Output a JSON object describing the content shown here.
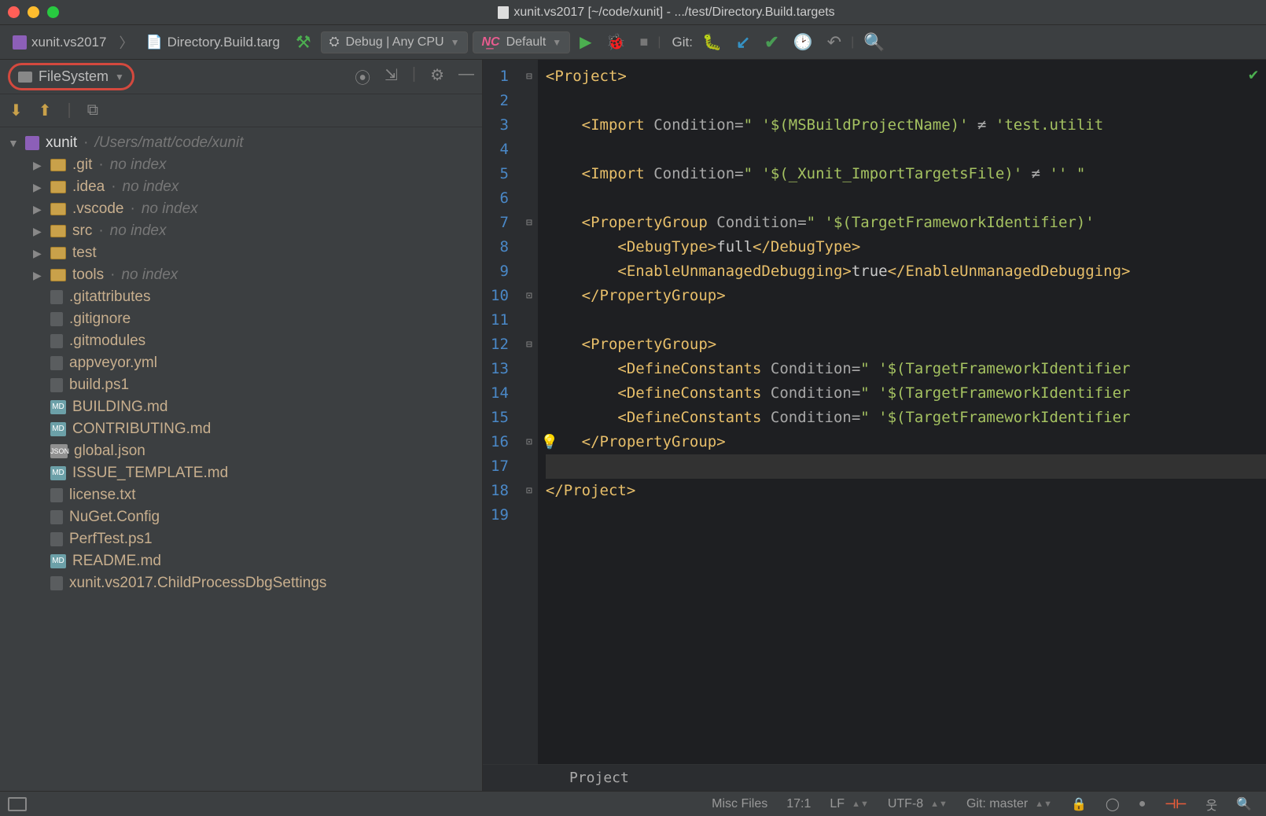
{
  "window": {
    "title": "xunit.vs2017 [~/code/xunit] - .../test/Directory.Build.targets"
  },
  "toolbar": {
    "breadcrumb1": "xunit.vs2017",
    "breadcrumb2": "Directory.Build.targ",
    "config": "Debug | Any CPU",
    "run_config": "Default",
    "git_label": "Git:"
  },
  "sidebar": {
    "scope": "FileSystem",
    "root": {
      "name": "xunit",
      "path": "/Users/matt/code/xunit"
    },
    "items": [
      {
        "name": ".git",
        "hint": "no index",
        "folder": true,
        "expandable": true
      },
      {
        "name": ".idea",
        "hint": "no index",
        "folder": true,
        "expandable": true
      },
      {
        "name": ".vscode",
        "hint": "no index",
        "folder": true,
        "expandable": true
      },
      {
        "name": "src",
        "hint": "no index",
        "folder": true,
        "expandable": true
      },
      {
        "name": "test",
        "folder": true,
        "expandable": true
      },
      {
        "name": "tools",
        "hint": "no index",
        "folder": true,
        "expandable": true
      },
      {
        "name": ".gitattributes",
        "icon": "file"
      },
      {
        "name": ".gitignore",
        "icon": "file"
      },
      {
        "name": ".gitmodules",
        "icon": "file"
      },
      {
        "name": "appveyor.yml",
        "icon": "file"
      },
      {
        "name": "build.ps1",
        "icon": "file"
      },
      {
        "name": "BUILDING.md",
        "icon": "md"
      },
      {
        "name": "CONTRIBUTING.md",
        "icon": "md"
      },
      {
        "name": "global.json",
        "icon": "json"
      },
      {
        "name": "ISSUE_TEMPLATE.md",
        "icon": "md"
      },
      {
        "name": "license.txt",
        "icon": "file"
      },
      {
        "name": "NuGet.Config",
        "icon": "file"
      },
      {
        "name": "PerfTest.ps1",
        "icon": "file"
      },
      {
        "name": "README.md",
        "icon": "md"
      },
      {
        "name": "xunit.vs2017.ChildProcessDbgSettings",
        "icon": "file"
      }
    ]
  },
  "editor": {
    "breadcrumb": "Project",
    "lines": [
      {
        "n": 1,
        "html": "<span class='tag'>&lt;Project&gt;</span>"
      },
      {
        "n": 2,
        "html": ""
      },
      {
        "n": 3,
        "html": "    <span class='tag'>&lt;Import</span> <span class='attr'>Condition=</span><span class='val'>\" '$(MSBuildProjectName)' </span><span class='op'>≠</span><span class='val'> 'test.utilit</span>"
      },
      {
        "n": 4,
        "html": ""
      },
      {
        "n": 5,
        "html": "    <span class='tag'>&lt;Import</span> <span class='attr'>Condition=</span><span class='val'>\" '$(_Xunit_ImportTargetsFile)' </span><span class='op'>≠</span><span class='val'> '' \" </span>"
      },
      {
        "n": 6,
        "html": ""
      },
      {
        "n": 7,
        "html": "    <span class='tag'>&lt;PropertyGroup</span> <span class='attr'>Condition=</span><span class='val'>\" '$(TargetFrameworkIdentifier)' </span>"
      },
      {
        "n": 8,
        "html": "        <span class='tag'>&lt;DebugType&gt;</span><span class='txt'>full</span><span class='tag'>&lt;/DebugType&gt;</span>"
      },
      {
        "n": 9,
        "html": "        <span class='tag'>&lt;EnableUnmanagedDebugging&gt;</span><span class='txt'>true</span><span class='tag'>&lt;/EnableUnmanagedDebugging&gt;</span>"
      },
      {
        "n": 10,
        "html": "    <span class='tag'>&lt;/PropertyGroup&gt;</span>"
      },
      {
        "n": 11,
        "html": ""
      },
      {
        "n": 12,
        "html": "    <span class='tag'>&lt;PropertyGroup&gt;</span>"
      },
      {
        "n": 13,
        "html": "        <span class='tag'>&lt;DefineConstants</span> <span class='attr'>Condition=</span><span class='val'>\" '$(TargetFrameworkIdentifier</span>"
      },
      {
        "n": 14,
        "html": "        <span class='tag'>&lt;DefineConstants</span> <span class='attr'>Condition=</span><span class='val'>\" '$(TargetFrameworkIdentifier</span>"
      },
      {
        "n": 15,
        "html": "        <span class='tag'>&lt;DefineConstants</span> <span class='attr'>Condition=</span><span class='val'>\" '$(TargetFrameworkIdentifier</span>"
      },
      {
        "n": 16,
        "html": "    <span class='tag'>&lt;/PropertyGroup&gt;</span>",
        "bulb": true
      },
      {
        "n": 17,
        "html": "",
        "current": true
      },
      {
        "n": 18,
        "html": "<span class='tag'>&lt;/Project&gt;</span>"
      },
      {
        "n": 19,
        "html": ""
      }
    ]
  },
  "status": {
    "file_type": "Misc Files",
    "cursor": "17:1",
    "line_sep": "LF",
    "encoding": "UTF-8",
    "git": "Git: master"
  }
}
